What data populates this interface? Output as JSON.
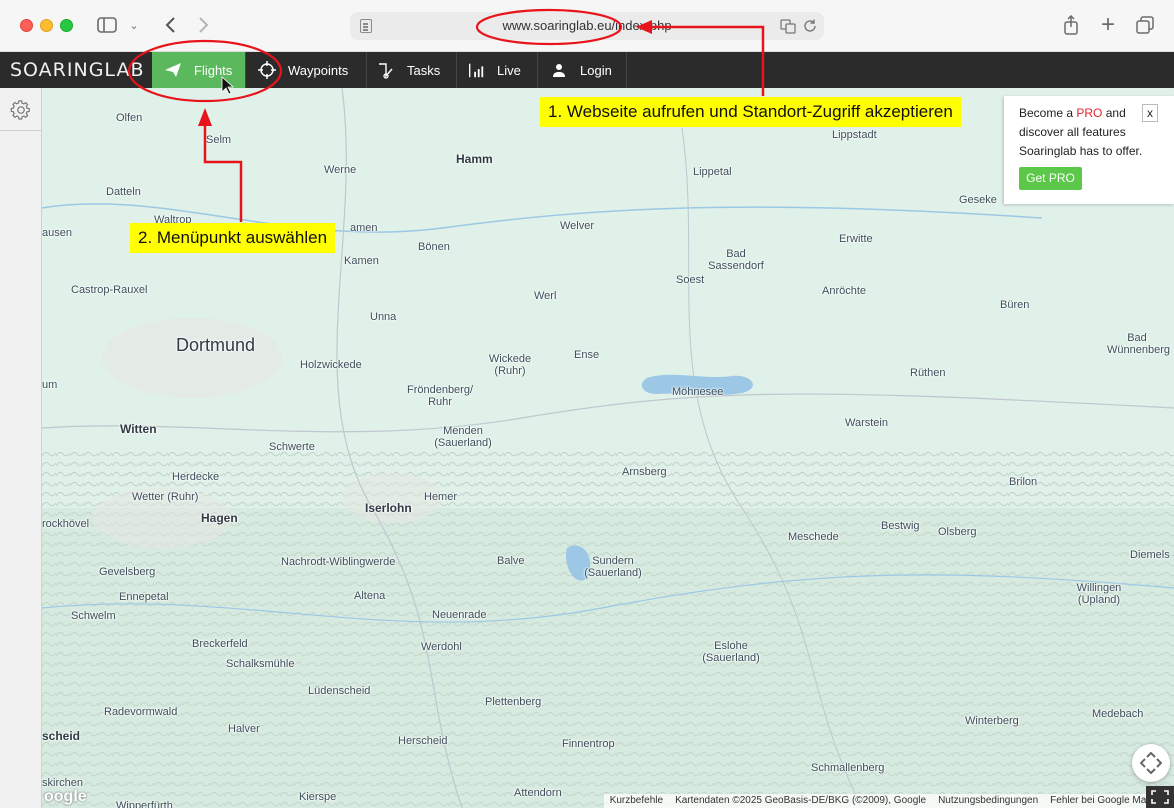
{
  "browser": {
    "url": "www.soaringlab.eu/index.php",
    "icons": [
      "sidebar-toggle-icon",
      "chevron-down-icon",
      "back-icon",
      "forward-icon",
      "translate-icon",
      "reload-icon",
      "share-icon",
      "new-tab-icon",
      "tabs-overview-icon"
    ]
  },
  "app": {
    "brand": "SOARINGLAB",
    "nav": [
      {
        "label": "Flights",
        "icon": "plane-icon",
        "active": true
      },
      {
        "label": "Waypoints",
        "icon": "crosshair-icon",
        "active": false
      },
      {
        "label": "Tasks",
        "icon": "tasks-icon",
        "active": false
      },
      {
        "label": "Live",
        "icon": "signal-icon",
        "active": false
      },
      {
        "label": "Login",
        "icon": "user-icon",
        "active": false
      }
    ],
    "accent": "#5cb85c"
  },
  "pro_box": {
    "line1_pre": "Become a ",
    "line1_accent": "PRO",
    "line1_post": " and",
    "line2": "discover all features",
    "line3": "Soaringlab has to offer.",
    "button": "Get PRO",
    "close": "x"
  },
  "annotations": {
    "step1": "1. Webseite aufrufen und Standort-Zugriff akzeptieren",
    "step2": "2. Menüpunkt auswählen"
  },
  "map": {
    "places": [
      "Olfen",
      "Selm",
      "Hamm",
      "Werne",
      "Lippetal",
      "Lippstadt",
      "Geseke",
      "Datteln",
      "Waltrop",
      "ausen",
      "amen",
      "Bönen",
      "Welver",
      "Erwitte",
      "Kamen",
      "Bad Sassendorf",
      "Soest",
      "Castrop-Rauxel",
      "Werl",
      "Anröchte",
      "Büren",
      "Unna",
      "Dortmund",
      "Holzwickede",
      "Wickede (Ruhr)",
      "Ense",
      "Bad Wünnenberg",
      "um",
      "Fröndenberg/ Ruhr",
      "Möhnesee",
      "Rüthen",
      "Witten",
      "Menden (Sauerland)",
      "Warstein",
      "Schwerte",
      "Herdecke",
      "Arnsberg",
      "Brilon",
      "Wetter (Ruhr)",
      "Hemer",
      "Iserlohn",
      "Hagen",
      "rockhövel",
      "Bestwig",
      "Olsberg",
      "Meschede",
      "Nachrodt-Wiblingwerde",
      "Balve",
      "Sundern (Sauerland)",
      "Diemels",
      "Gevelsberg",
      "Ennepetal",
      "Altena",
      "Willingen (Upland)",
      "Schwelm",
      "Neuenrade",
      "Breckerfeld",
      "Werdohl",
      "Eslohe (Sauerland)",
      "Schalksmühle",
      "Lüdenscheid",
      "Plettenberg",
      "Radevormwald",
      "Medebach",
      "Halver",
      "Winterberg",
      "scheid",
      "Herscheid",
      "Finnentrop",
      "Schmallenberg",
      "skirchen",
      "Attendorn",
      "Kierspe",
      "Wipperfürth"
    ],
    "attribution": [
      "Kurzbefehle",
      "Kartendaten ©2025 GeoBasis-DE/BKG (©2009), Google",
      "Nutzungsbedingungen",
      "Fehler bei Google Maps m"
    ],
    "logo": "oogle",
    "settings_icon": "gear-icon"
  }
}
